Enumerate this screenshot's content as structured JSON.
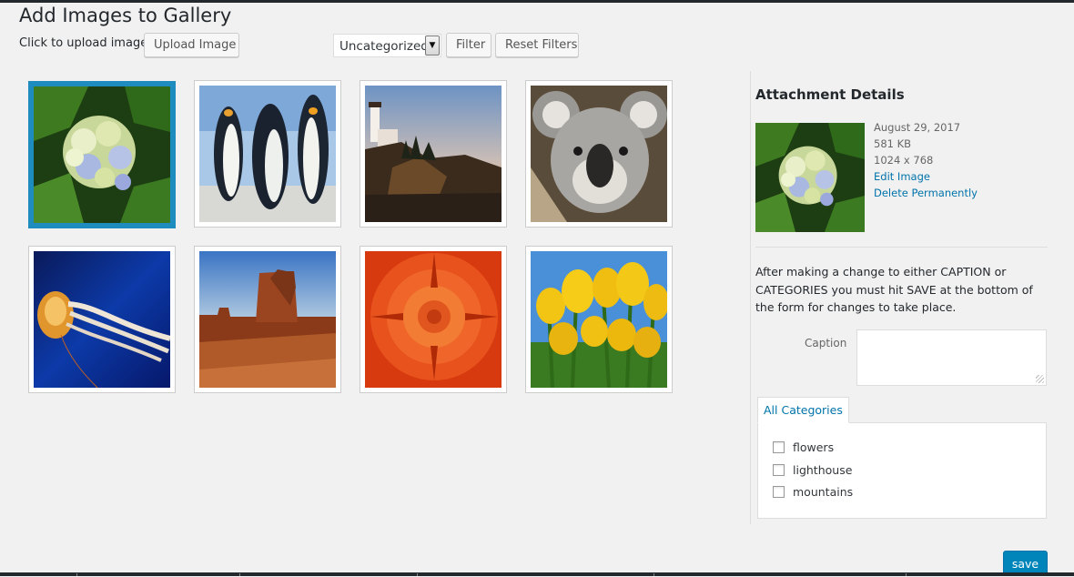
{
  "page": {
    "title": "Add Images to Gallery",
    "upload_label": "Click to upload images"
  },
  "toolbar": {
    "upload_button": "Upload Image",
    "category_select": {
      "selected": "Uncategorized"
    },
    "filter_button": "Filter",
    "reset_button": "Reset Filters"
  },
  "gallery": {
    "selected_index": 0,
    "images": [
      {
        "subject": "hydrangea-flowers",
        "icon": "hydrangea-image"
      },
      {
        "subject": "penguins",
        "icon": "penguins-image"
      },
      {
        "subject": "lighthouse",
        "icon": "lighthouse-image"
      },
      {
        "subject": "koala",
        "icon": "koala-image"
      },
      {
        "subject": "jellyfish",
        "icon": "jellyfish-image"
      },
      {
        "subject": "desert-mesa",
        "icon": "desert-image"
      },
      {
        "subject": "chrysanthemum",
        "icon": "chrysanthemum-image"
      },
      {
        "subject": "tulips",
        "icon": "tulips-image"
      }
    ]
  },
  "details": {
    "title": "Attachment Details",
    "date": "August 29, 2017",
    "filesize": "581 KB",
    "dimensions": "1024 x 768",
    "edit_link": "Edit Image",
    "delete_link": "Delete Permanently",
    "help_text": "After making a change to either CAPTION or CATEGORIES you must hit SAVE at the bottom of the form for changes to take place.",
    "caption_label": "Caption",
    "caption_value": "",
    "categories_tab": "All Categories",
    "categories": [
      {
        "label": "flowers",
        "checked": false
      },
      {
        "label": "lighthouse",
        "checked": false
      },
      {
        "label": "mountains",
        "checked": false
      }
    ]
  },
  "save_button": "save",
  "colors": {
    "accent": "#0085ba",
    "link": "#0073aa",
    "selection_border": "#1e8cbe",
    "background": "#f1f1f1"
  }
}
